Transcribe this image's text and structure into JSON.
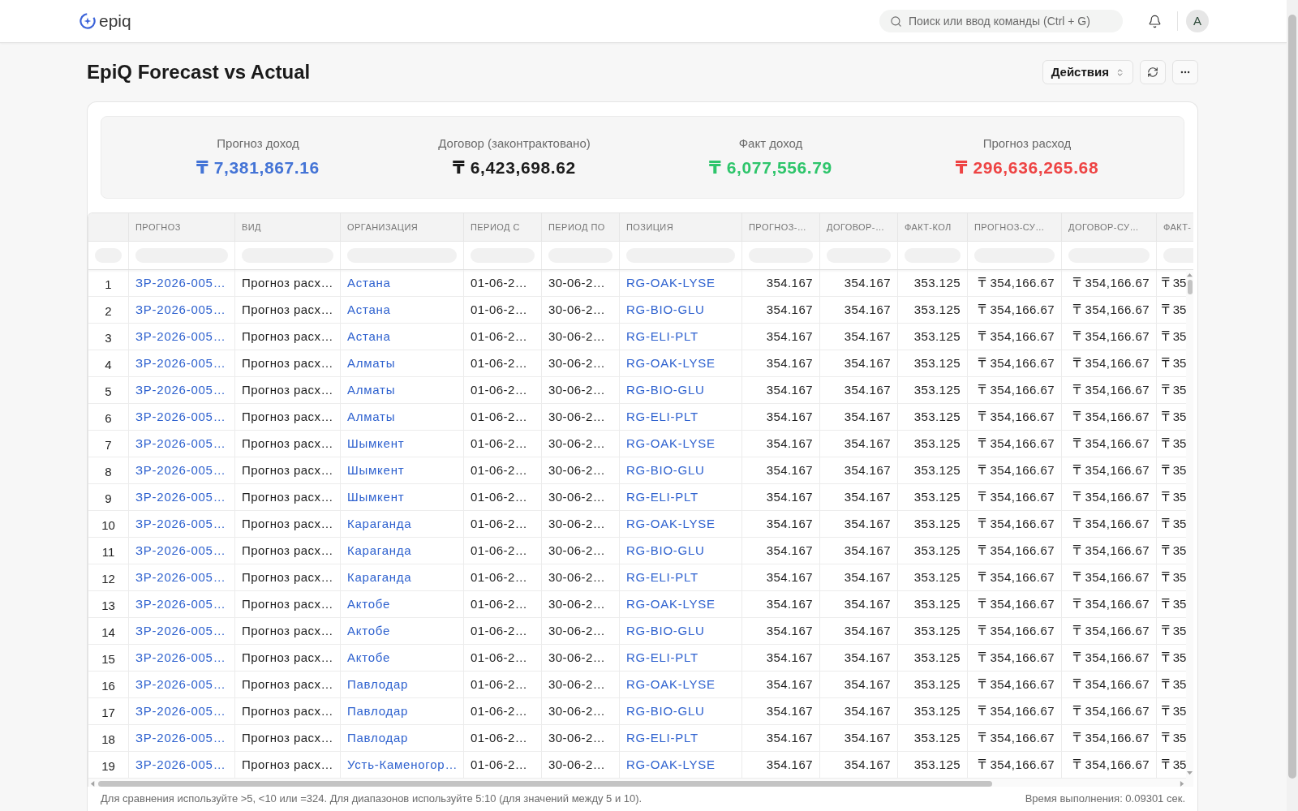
{
  "topbar": {
    "logo": "epiq",
    "search": {
      "placeholder": "Поиск или ввод команды (Ctrl + G)"
    },
    "avatar": "A"
  },
  "page_header": {
    "title": "EpiQ Forecast vs Actual",
    "actions_button": "Действия"
  },
  "summary": [
    {
      "label": "Прогноз доход",
      "value": "₸ 7,381,867.16",
      "color": "#4474d6"
    },
    {
      "label": "Договор (законтрактовано)",
      "value": "₸ 6,423,698.62",
      "color": "#1c1c1c"
    },
    {
      "label": "Факт доход",
      "value": "₸ 6,077,556.79",
      "color": "#2ec56b"
    },
    {
      "label": "Прогноз расход",
      "value": "₸ 296,636,265.68",
      "color": "#ee4444"
    }
  ],
  "table": {
    "columns": [
      {
        "label": "ПРОГНОЗ",
        "kind": "link"
      },
      {
        "label": "ВИД",
        "kind": "text"
      },
      {
        "label": "ОРГАНИЗАЦИЯ",
        "kind": "link"
      },
      {
        "label": "ПЕРИОД С",
        "kind": "text"
      },
      {
        "label": "ПЕРИОД ПО",
        "kind": "text"
      },
      {
        "label": "ПОЗИЦИЯ",
        "kind": "link"
      },
      {
        "label": "ПРОГНОЗ-…",
        "kind": "number"
      },
      {
        "label": "ДОГОВОР-…",
        "kind": "number"
      },
      {
        "label": "ФАКТ-КОЛ",
        "kind": "number"
      },
      {
        "label": "ПРОГНОЗ-СУ…",
        "kind": "number"
      },
      {
        "label": "ДОГОВОР-СУ…",
        "kind": "number"
      },
      {
        "label": "ФАКТ-",
        "kind": "partial"
      }
    ],
    "rows": [
      {
        "number": "1",
        "cells": [
          "ЗР-2026-005…",
          "Прогноз расх…",
          "Астана",
          "01-06-2…",
          "30-06-2…",
          "RG-OAK-LYSE",
          "354.167",
          "354.167",
          "353.125",
          "₸ 354,166.67",
          "₸ 354,166.67",
          "₸ 35"
        ]
      },
      {
        "number": "2",
        "cells": [
          "ЗР-2026-005…",
          "Прогноз расх…",
          "Астана",
          "01-06-2…",
          "30-06-2…",
          "RG-BIO-GLU",
          "354.167",
          "354.167",
          "353.125",
          "₸ 354,166.67",
          "₸ 354,166.67",
          "₸ 35"
        ]
      },
      {
        "number": "3",
        "cells": [
          "ЗР-2026-005…",
          "Прогноз расх…",
          "Астана",
          "01-06-2…",
          "30-06-2…",
          "RG-ELI-PLT",
          "354.167",
          "354.167",
          "353.125",
          "₸ 354,166.67",
          "₸ 354,166.67",
          "₸ 35"
        ]
      },
      {
        "number": "4",
        "cells": [
          "ЗР-2026-005…",
          "Прогноз расх…",
          "Алматы",
          "01-06-2…",
          "30-06-2…",
          "RG-OAK-LYSE",
          "354.167",
          "354.167",
          "353.125",
          "₸ 354,166.67",
          "₸ 354,166.67",
          "₸ 35"
        ]
      },
      {
        "number": "5",
        "cells": [
          "ЗР-2026-005…",
          "Прогноз расх…",
          "Алматы",
          "01-06-2…",
          "30-06-2…",
          "RG-BIO-GLU",
          "354.167",
          "354.167",
          "353.125",
          "₸ 354,166.67",
          "₸ 354,166.67",
          "₸ 35"
        ]
      },
      {
        "number": "6",
        "cells": [
          "ЗР-2026-005…",
          "Прогноз расх…",
          "Алматы",
          "01-06-2…",
          "30-06-2…",
          "RG-ELI-PLT",
          "354.167",
          "354.167",
          "353.125",
          "₸ 354,166.67",
          "₸ 354,166.67",
          "₸ 35"
        ]
      },
      {
        "number": "7",
        "cells": [
          "ЗР-2026-005…",
          "Прогноз расх…",
          "Шымкент",
          "01-06-2…",
          "30-06-2…",
          "RG-OAK-LYSE",
          "354.167",
          "354.167",
          "353.125",
          "₸ 354,166.67",
          "₸ 354,166.67",
          "₸ 35"
        ]
      },
      {
        "number": "8",
        "cells": [
          "ЗР-2026-005…",
          "Прогноз расх…",
          "Шымкент",
          "01-06-2…",
          "30-06-2…",
          "RG-BIO-GLU",
          "354.167",
          "354.167",
          "353.125",
          "₸ 354,166.67",
          "₸ 354,166.67",
          "₸ 35"
        ]
      },
      {
        "number": "9",
        "cells": [
          "ЗР-2026-005…",
          "Прогноз расх…",
          "Шымкент",
          "01-06-2…",
          "30-06-2…",
          "RG-ELI-PLT",
          "354.167",
          "354.167",
          "353.125",
          "₸ 354,166.67",
          "₸ 354,166.67",
          "₸ 35"
        ]
      },
      {
        "number": "10",
        "cells": [
          "ЗР-2026-005…",
          "Прогноз расх…",
          "Караганда",
          "01-06-2…",
          "30-06-2…",
          "RG-OAK-LYSE",
          "354.167",
          "354.167",
          "353.125",
          "₸ 354,166.67",
          "₸ 354,166.67",
          "₸ 35"
        ]
      },
      {
        "number": "11",
        "cells": [
          "ЗР-2026-005…",
          "Прогноз расх…",
          "Караганда",
          "01-06-2…",
          "30-06-2…",
          "RG-BIO-GLU",
          "354.167",
          "354.167",
          "353.125",
          "₸ 354,166.67",
          "₸ 354,166.67",
          "₸ 35"
        ]
      },
      {
        "number": "12",
        "cells": [
          "ЗР-2026-005…",
          "Прогноз расх…",
          "Караганда",
          "01-06-2…",
          "30-06-2…",
          "RG-ELI-PLT",
          "354.167",
          "354.167",
          "353.125",
          "₸ 354,166.67",
          "₸ 354,166.67",
          "₸ 35"
        ]
      },
      {
        "number": "13",
        "cells": [
          "ЗР-2026-005…",
          "Прогноз расх…",
          "Актобе",
          "01-06-2…",
          "30-06-2…",
          "RG-OAK-LYSE",
          "354.167",
          "354.167",
          "353.125",
          "₸ 354,166.67",
          "₸ 354,166.67",
          "₸ 35"
        ]
      },
      {
        "number": "14",
        "cells": [
          "ЗР-2026-005…",
          "Прогноз расх…",
          "Актобе",
          "01-06-2…",
          "30-06-2…",
          "RG-BIO-GLU",
          "354.167",
          "354.167",
          "353.125",
          "₸ 354,166.67",
          "₸ 354,166.67",
          "₸ 35"
        ]
      },
      {
        "number": "15",
        "cells": [
          "ЗР-2026-005…",
          "Прогноз расх…",
          "Актобе",
          "01-06-2…",
          "30-06-2…",
          "RG-ELI-PLT",
          "354.167",
          "354.167",
          "353.125",
          "₸ 354,166.67",
          "₸ 354,166.67",
          "₸ 35"
        ]
      },
      {
        "number": "16",
        "cells": [
          "ЗР-2026-005…",
          "Прогноз расх…",
          "Павлодар",
          "01-06-2…",
          "30-06-2…",
          "RG-OAK-LYSE",
          "354.167",
          "354.167",
          "353.125",
          "₸ 354,166.67",
          "₸ 354,166.67",
          "₸ 35"
        ]
      },
      {
        "number": "17",
        "cells": [
          "ЗР-2026-005…",
          "Прогноз расх…",
          "Павлодар",
          "01-06-2…",
          "30-06-2…",
          "RG-BIO-GLU",
          "354.167",
          "354.167",
          "353.125",
          "₸ 354,166.67",
          "₸ 354,166.67",
          "₸ 35"
        ]
      },
      {
        "number": "18",
        "cells": [
          "ЗР-2026-005…",
          "Прогноз расх…",
          "Павлодар",
          "01-06-2…",
          "30-06-2…",
          "RG-ELI-PLT",
          "354.167",
          "354.167",
          "353.125",
          "₸ 354,166.67",
          "₸ 354,166.67",
          "₸ 35"
        ]
      },
      {
        "number": "19",
        "cells": [
          "ЗР-2026-005…",
          "Прогноз расх…",
          "Усть-Каменогор…",
          "01-06-2…",
          "30-06-2…",
          "RG-OAK-LYSE",
          "354.167",
          "354.167",
          "353.125",
          "₸ 354,166.67",
          "₸ 354,166.67",
          "₸ 35"
        ]
      }
    ]
  },
  "footer": {
    "hint": "Для сравнения используйте >5, <10 или =324. Для диапазонов используйте 5:10 (для значений между 5 и 10).",
    "execution_time": "Время выполнения: 0.09301 сек."
  }
}
